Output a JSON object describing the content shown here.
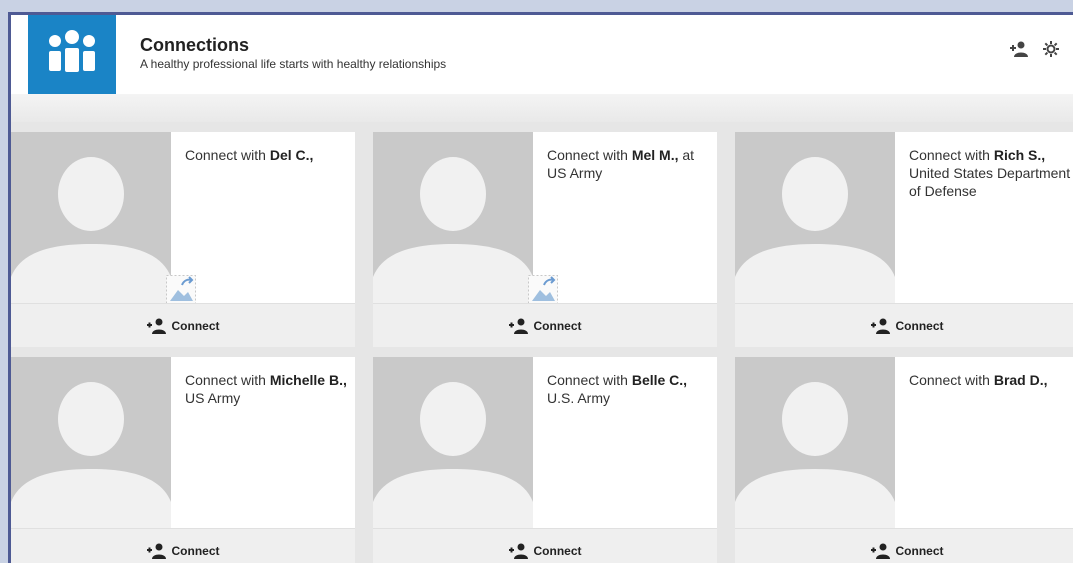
{
  "header": {
    "title": "Connections",
    "subtitle": "A healthy professional life starts with healthy relationships",
    "brand_color": "#1a84c6",
    "icons": [
      "add-connection-icon",
      "gear-icon"
    ]
  },
  "cards": [
    {
      "prefix": "Connect with",
      "name": "Del C.,",
      "detail": "",
      "button": "Connect",
      "broken_image": true
    },
    {
      "prefix": "Connect with",
      "name": "Mel M.,",
      "detail": "at US Army",
      "button": "Connect",
      "broken_image": true
    },
    {
      "prefix": "Connect with",
      "name": "Rich S.,",
      "detail": "United States Department of Defense",
      "button": "Connect",
      "broken_image": false
    },
    {
      "prefix": "Connect with",
      "name": "Michelle B.,",
      "detail": "US Army",
      "button": "Connect",
      "broken_image": false
    },
    {
      "prefix": "Connect with",
      "name": "Belle C.,",
      "detail": "U.S. Army",
      "button": "Connect",
      "broken_image": false
    },
    {
      "prefix": "Connect with",
      "name": "Brad D.,",
      "detail": "",
      "button": "Connect",
      "broken_image": false
    }
  ]
}
